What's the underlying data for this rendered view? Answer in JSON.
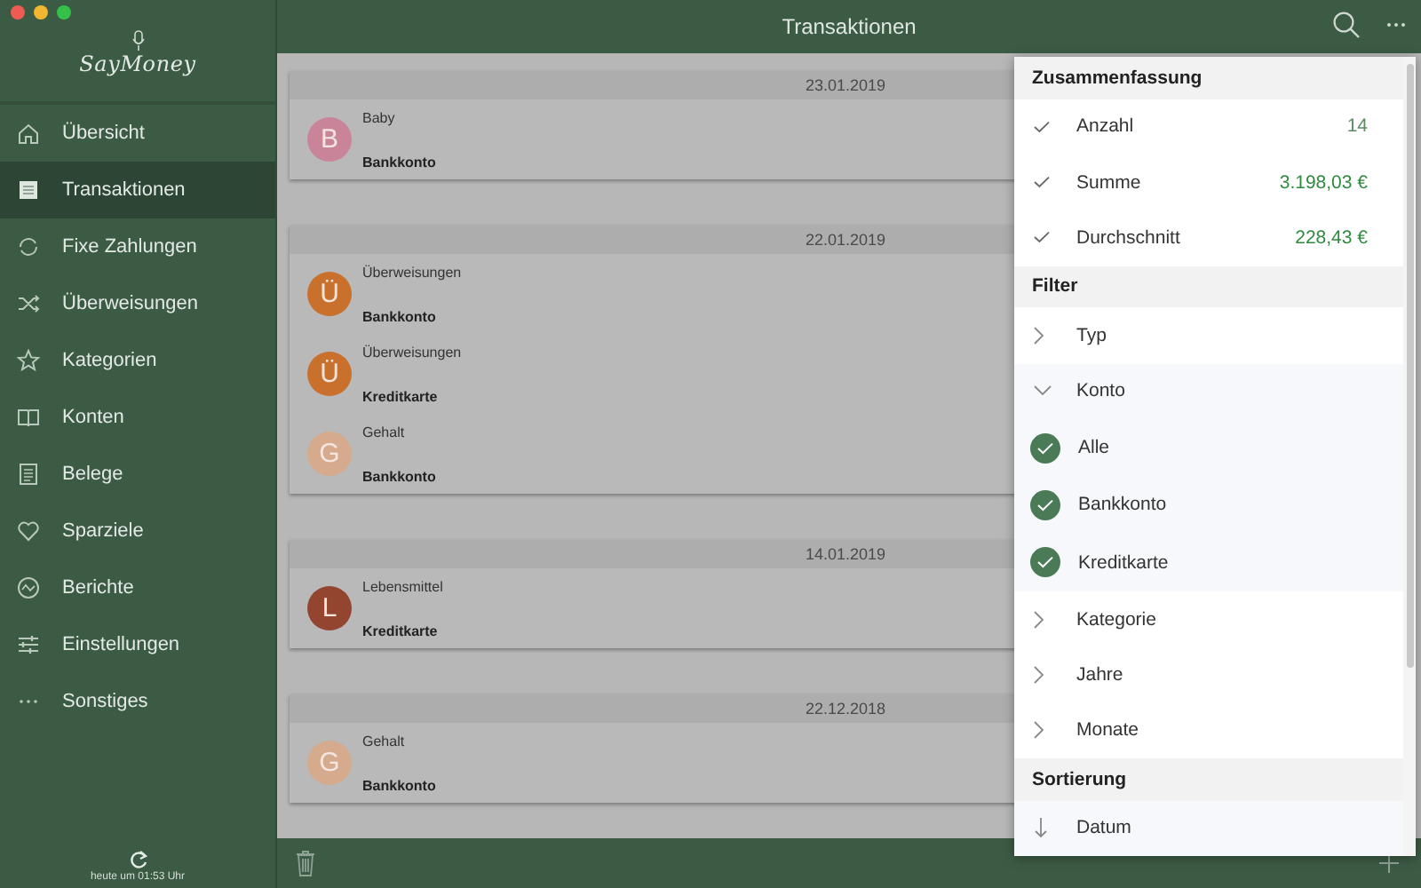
{
  "window": {
    "title": "Transaktionen"
  },
  "app": {
    "logo": "SayMoney"
  },
  "sidebar": {
    "items": [
      {
        "label": "Übersicht",
        "selected": false
      },
      {
        "label": "Transaktionen",
        "selected": true
      },
      {
        "label": "Fixe Zahlungen",
        "selected": false
      },
      {
        "label": "Überweisungen",
        "selected": false
      },
      {
        "label": "Kategorien",
        "selected": false
      },
      {
        "label": "Konten",
        "selected": false
      },
      {
        "label": "Belege",
        "selected": false
      },
      {
        "label": "Sparziele",
        "selected": false
      },
      {
        "label": "Berichte",
        "selected": false
      },
      {
        "label": "Einstellungen",
        "selected": false
      },
      {
        "label": "Sonstiges",
        "selected": false
      }
    ],
    "sync_status": "heute um 01:53 Uhr"
  },
  "transactions": [
    {
      "date": "23.01.2019",
      "entries": [
        {
          "initial": "B",
          "category": "Baby",
          "account": "Bankkonto",
          "color": "#c9849a"
        }
      ]
    },
    {
      "date": "22.01.2019",
      "entries": [
        {
          "initial": "Ü",
          "category": "Überweisungen",
          "account": "Bankkonto",
          "color": "#c9702c"
        },
        {
          "initial": "Ü",
          "category": "Überweisungen",
          "account": "Kreditkarte",
          "color": "#c9702c"
        },
        {
          "initial": "G",
          "category": "Gehalt",
          "account": "Bankkonto",
          "color": "#d6aa8c"
        }
      ]
    },
    {
      "date": "14.01.2019",
      "entries": [
        {
          "initial": "L",
          "category": "Lebensmittel",
          "account": "Kreditkarte",
          "color": "#944530"
        }
      ]
    },
    {
      "date": "22.12.2018",
      "entries": [
        {
          "initial": "G",
          "category": "Gehalt",
          "account": "Bankkonto",
          "color": "#d6aa8c"
        }
      ]
    }
  ],
  "panel": {
    "sections": [
      {
        "title": "Zusammenfassung",
        "rows": [
          {
            "kind": "summary",
            "label": "Anzahl",
            "value": "14",
            "checked": true,
            "color": "#5b8a64"
          },
          {
            "kind": "summary",
            "label": "Summe",
            "value": "3.198,03 €",
            "checked": true,
            "color": "#2e8b3e"
          },
          {
            "kind": "summary",
            "label": "Durchschnitt",
            "value": "228,43 €",
            "checked": true,
            "color": "#2e8b3e"
          }
        ]
      },
      {
        "title": "Filter",
        "rows": [
          {
            "kind": "group",
            "label": "Typ",
            "expanded": false
          },
          {
            "kind": "group",
            "label": "Konto",
            "expanded": true,
            "children": [
              {
                "label": "Alle",
                "checked": true
              },
              {
                "label": "Bankkonto",
                "checked": true
              },
              {
                "label": "Kreditkarte",
                "checked": true
              }
            ]
          },
          {
            "kind": "group",
            "label": "Kategorie",
            "expanded": false
          },
          {
            "kind": "group",
            "label": "Jahre",
            "expanded": false
          },
          {
            "kind": "group",
            "label": "Monate",
            "expanded": false
          }
        ]
      },
      {
        "title": "Sortierung",
        "rows": [
          {
            "kind": "sort",
            "label": "Datum"
          }
        ]
      }
    ]
  }
}
